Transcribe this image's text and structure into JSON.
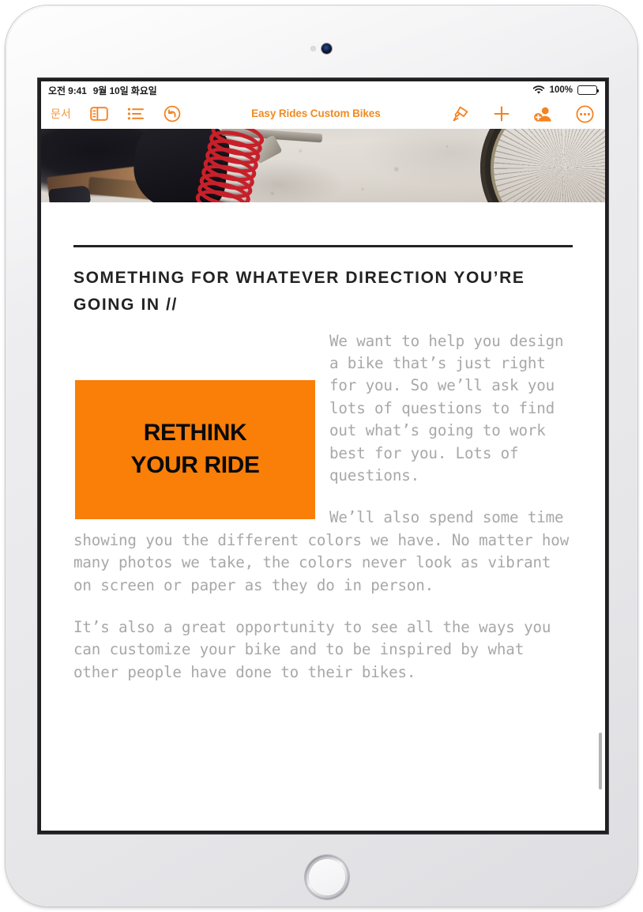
{
  "status_bar": {
    "time": "오전 9:41",
    "date": "9월 10일 화요일",
    "wifi_icon": "wifi-icon",
    "battery_percent": "100%",
    "battery_icon": "battery-full-icon"
  },
  "toolbar": {
    "documents_label": "문서",
    "view_options_icon": "sidebar-layout-icon",
    "table_of_contents_icon": "list-bullet-icon",
    "undo_icon": "undo-arrow-icon",
    "document_title": "Easy Rides Custom Bikes",
    "format_icon": "paintbrush-icon",
    "insert_icon": "plus-icon",
    "collaborate_icon": "add-person-icon",
    "more_icon": "ellipsis-circle-icon",
    "accent_color": "#f58220",
    "title_color": "#ef8b22"
  },
  "document": {
    "hero_image_alt": "Cyclist leg beside a bicycle wheel with a red coiled cable lock on concrete",
    "heading": "SOMETHING FOR WHATEVER DIRECTION YOU’RE GOING IN //",
    "heading_color": "#232323",
    "rule_color": "#232323",
    "body_color": "#a8a8a8",
    "paragraphs": [
      "We want to help you design a bike that’s just right for you. So we’ll ask you lots of questions to find out what’s going to work best for you. Lots of questions.",
      "We’ll also spend some time showing you the different colors we have. No matter how many photos we take, the colors never look as vibrant on screen or paper as they do in person.",
      "It’s also a great opportunity to see all the ways you can customize your bike and to be inspired by what other people have done to their bikes."
    ],
    "callout_box": {
      "background_color": "#f97f08",
      "text_color": "#0a0a0a",
      "line1": "RETHINK",
      "line2": "YOUR RIDE"
    }
  }
}
